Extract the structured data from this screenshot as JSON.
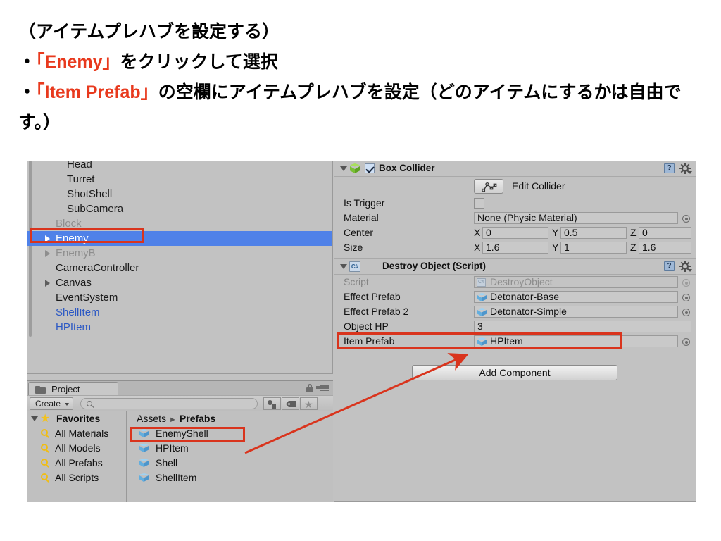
{
  "slide": {
    "lines": [
      {
        "parts": [
          {
            "t": "（アイテムプレハブを設定する）",
            "hl": false
          }
        ]
      },
      {
        "parts": [
          {
            "t": "・",
            "hl": false
          },
          {
            "t": "「Enemy」",
            "hl": true
          },
          {
            "t": "をクリックして選択",
            "hl": false
          }
        ]
      },
      {
        "parts": [
          {
            "t": "・",
            "hl": false
          },
          {
            "t": "「Item Prefab」",
            "hl": true
          },
          {
            "t": "の空欄にアイテムプレハブを設定（どのアイテムにするかは自由です。）",
            "hl": false
          }
        ]
      }
    ],
    "highlight_color": "#e8391d",
    "text_color": "#000000"
  },
  "hierarchy": {
    "items": [
      {
        "label": "Head",
        "indent": 56,
        "arrow": false,
        "state": "normal"
      },
      {
        "label": "Turret",
        "indent": 56,
        "arrow": false,
        "state": "normal"
      },
      {
        "label": "ShotShell",
        "indent": 56,
        "arrow": false,
        "state": "normal"
      },
      {
        "label": "SubCamera",
        "indent": 56,
        "arrow": false,
        "state": "normal"
      },
      {
        "label": "Block",
        "indent": 40,
        "arrow": false,
        "state": "dim"
      },
      {
        "label": "Enemy",
        "indent": 40,
        "arrow": true,
        "state": "selected"
      },
      {
        "label": "EnemyB",
        "indent": 40,
        "arrow": true,
        "state": "dim"
      },
      {
        "label": "CameraController",
        "indent": 40,
        "arrow": false,
        "state": "normal"
      },
      {
        "label": "Canvas",
        "indent": 40,
        "arrow": true,
        "state": "normal"
      },
      {
        "label": "EventSystem",
        "indent": 40,
        "arrow": false,
        "state": "normal"
      },
      {
        "label": "ShellItem",
        "indent": 40,
        "arrow": false,
        "state": "prefab"
      },
      {
        "label": "HPItem",
        "indent": 40,
        "arrow": false,
        "state": "prefab"
      }
    ],
    "selection_color": "#4f81e8",
    "prefab_color": "#2b58c4",
    "highlight_box_color": "#d9341d"
  },
  "project": {
    "tab_label": "Project",
    "create_button": "Create",
    "search_placeholder": "",
    "search_value": "",
    "toolbar_icons": [
      "shapes-filter-icon",
      "tag-filter-icon",
      "favorite-filter-icon"
    ],
    "favorites": {
      "header": "Favorites",
      "items": [
        "All Materials",
        "All Models",
        "All Prefabs",
        "All Scripts"
      ]
    },
    "breadcrumb": {
      "root": "Assets",
      "separator": "►",
      "current": "Prefabs"
    },
    "assets": [
      {
        "name": "EnemyShell",
        "highlighted": false
      },
      {
        "name": "HPItem",
        "highlighted": true
      },
      {
        "name": "Shell",
        "highlighted": false
      },
      {
        "name": "ShellItem",
        "highlighted": false
      }
    ]
  },
  "inspector": {
    "box_collider": {
      "title": "Box Collider",
      "enabled": true,
      "edit_collider_label": "Edit Collider",
      "is_trigger": {
        "label": "Is Trigger",
        "checked": false
      },
      "material": {
        "label": "Material",
        "value": "None (Physic Material)"
      },
      "center": {
        "label": "Center",
        "x_axis": "X",
        "x": "0",
        "y_axis": "Y",
        "y": "0.5",
        "z_axis": "Z",
        "z": "0"
      },
      "size": {
        "label": "Size",
        "x_axis": "X",
        "x": "1.6",
        "y_axis": "Y",
        "y": "1",
        "z_axis": "Z",
        "z": "1.6"
      }
    },
    "destroy_object": {
      "title": "Destroy Object (Script)",
      "rows": [
        {
          "label": "Script",
          "value": "DestroyObject",
          "icon": "cs-script-icon",
          "dim": true
        },
        {
          "label": "Effect Prefab",
          "value": "Detonator-Base",
          "icon": "prefab-cube-icon",
          "dim": false
        },
        {
          "label": "Effect Prefab 2",
          "value": "Detonator-Simple",
          "icon": "prefab-cube-icon",
          "dim": false
        },
        {
          "label": "Object HP",
          "value": "3",
          "icon": "none",
          "dim": false
        },
        {
          "label": "Item Prefab",
          "value": "HPItem",
          "icon": "prefab-cube-icon",
          "dim": false
        }
      ]
    },
    "add_component_label": "Add Component",
    "header_icons": [
      "help-icon",
      "gear-icon"
    ]
  },
  "annotation": {
    "arrow_color": "#d9341d",
    "box_color": "#d9341d"
  }
}
